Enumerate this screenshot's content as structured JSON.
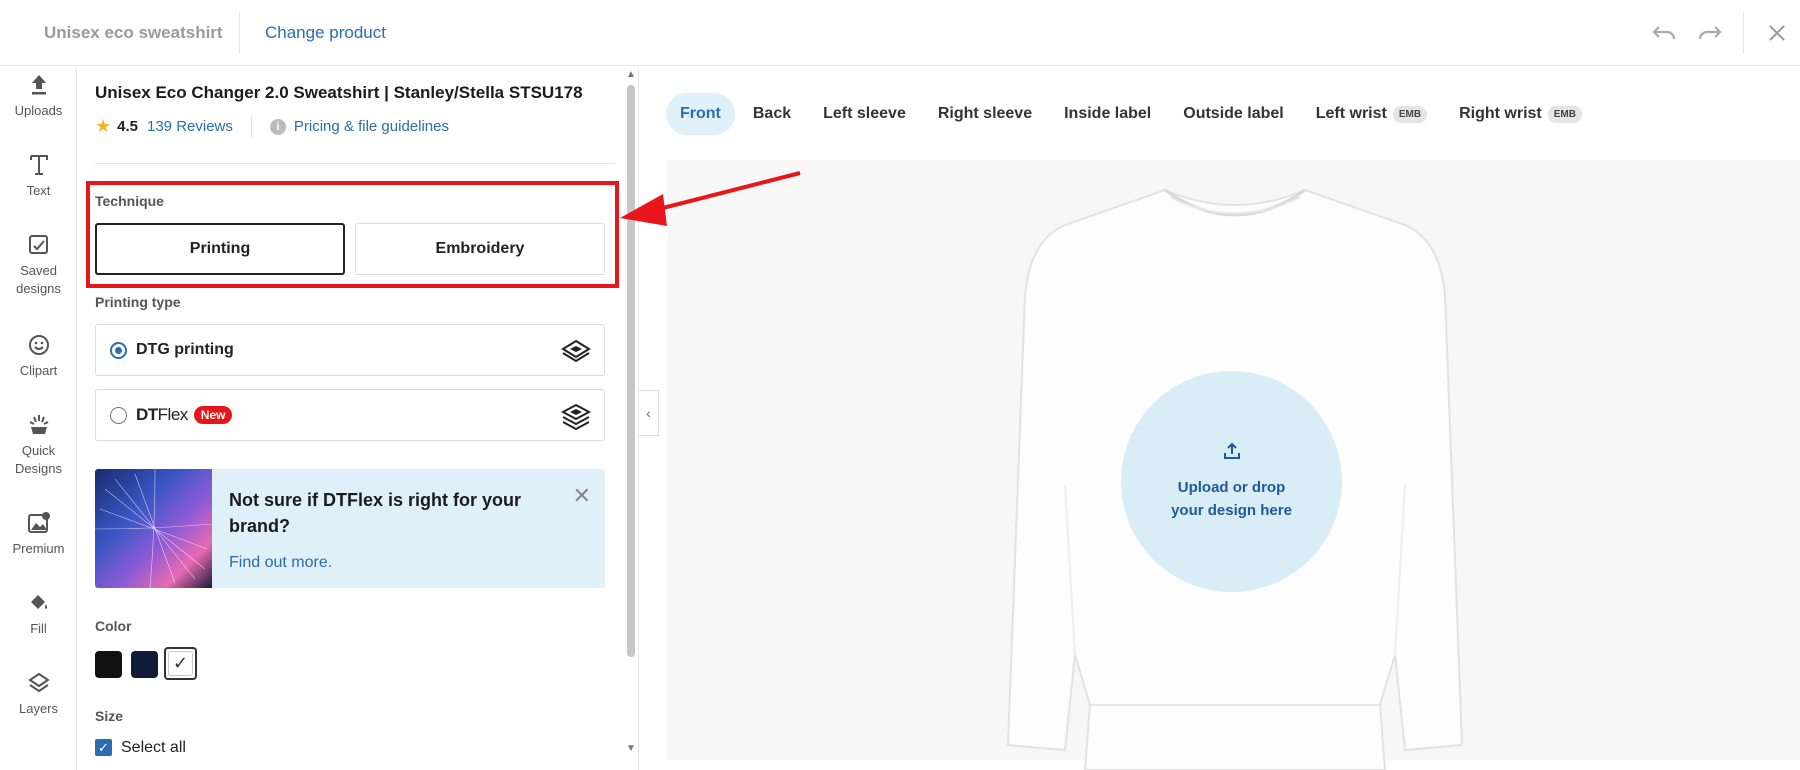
{
  "header": {
    "product_name": "Unisex eco sweatshirt",
    "change_product": "Change product"
  },
  "rail": [
    {
      "label": "Uploads",
      "icon": "upload-icon"
    },
    {
      "label": "Text",
      "icon": "text-icon"
    },
    {
      "label": "Saved designs",
      "icon": "saved-designs-icon"
    },
    {
      "label": "Clipart",
      "icon": "smiley-icon"
    },
    {
      "label": "Quick Designs",
      "icon": "quick-designs-icon"
    },
    {
      "label": "Premium",
      "icon": "premium-icon"
    },
    {
      "label": "Fill",
      "icon": "paint-bucket-icon"
    },
    {
      "label": "Layers",
      "icon": "layers-icon"
    }
  ],
  "panel": {
    "title": "Unisex Eco Changer 2.0 Sweatshirt | Stanley/Stella STSU178",
    "rating": "4.5",
    "reviews": "139 Reviews",
    "guidelines": "Pricing & file guidelines",
    "technique_label": "Technique",
    "technique_options": [
      "Printing",
      "Embroidery"
    ],
    "printing_type_label": "Printing type",
    "dtg": "DTG printing",
    "dtflex_bold": "DT",
    "dtflex_light": "Flex",
    "new_badge": "New",
    "promo_title": "Not sure if DTFlex is right for your brand?",
    "promo_link": "Find out more.",
    "color_label": "Color",
    "colors": [
      "#111111",
      "#0f1d3a",
      "#ffffff"
    ],
    "size_label": "Size",
    "select_all": "Select all"
  },
  "tabs": [
    {
      "label": "Front",
      "active": true
    },
    {
      "label": "Back"
    },
    {
      "label": "Left sleeve"
    },
    {
      "label": "Right sleeve"
    },
    {
      "label": "Inside label"
    },
    {
      "label": "Outside label"
    },
    {
      "label": "Left wrist",
      "badge": "EMB"
    },
    {
      "label": "Right wrist",
      "badge": "EMB"
    }
  ],
  "upload": {
    "line1": "Upload or drop",
    "line2": "your design here"
  },
  "accent": "#2a6db0",
  "highlight_color": "#e8161b"
}
